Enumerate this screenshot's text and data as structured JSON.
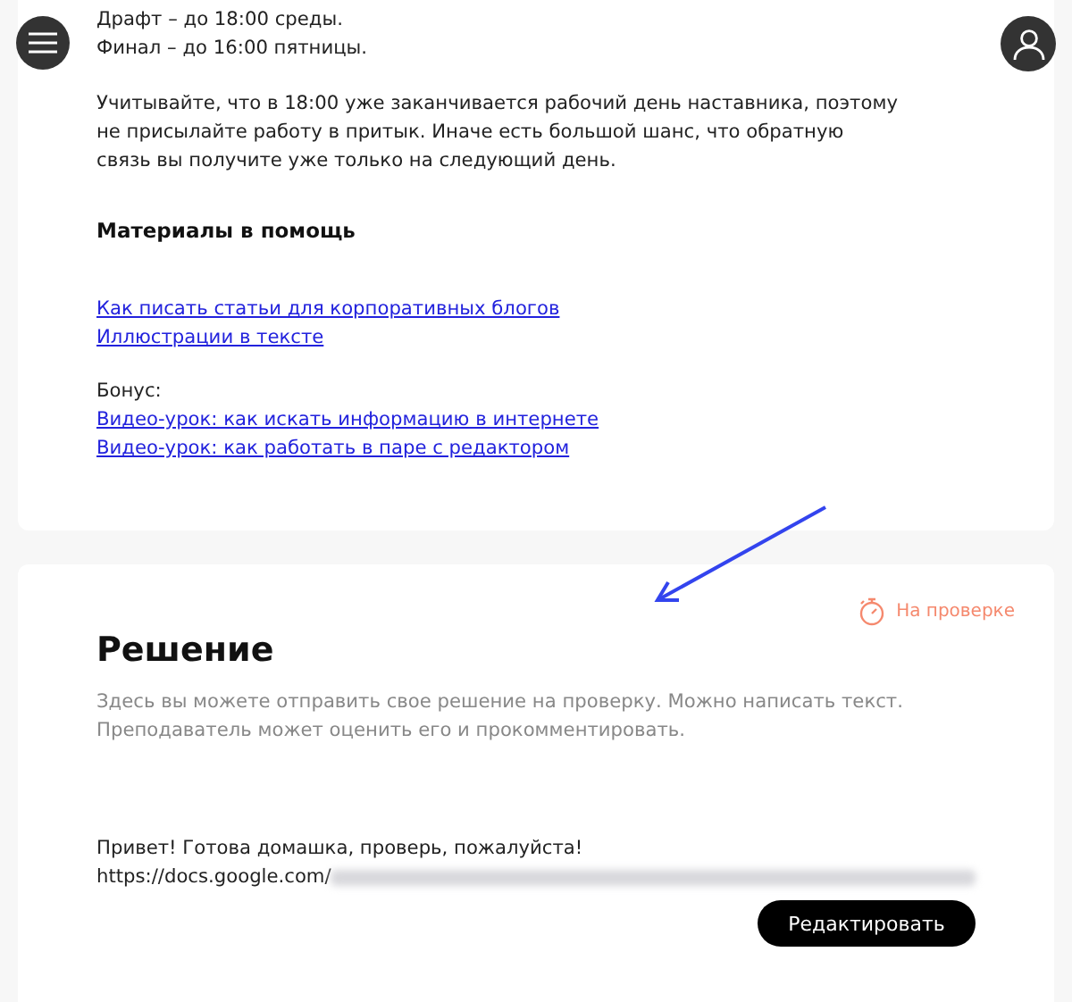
{
  "intro_lines": [
    "Драфт – до 18:00 среды.",
    "Финал – до 16:00 пятницы."
  ],
  "note": "Учитывайте, что в 18:00 уже заканчивается рабочий день наставника, поэтому не присылайте работу в притык. Иначе есть большой шанс, что обратную связь вы получите уже только на следующий день.",
  "materials": {
    "title": "Материалы в помощь",
    "links": [
      "Как писать статьи для корпоративных блогов",
      "Иллюстрации в тексте"
    ],
    "bonus_label": "Бонус:",
    "bonus_links": [
      "Видео-урок: как искать информацию в интернете",
      "Видео-урок: как работать в паре с редактором"
    ]
  },
  "solution": {
    "title": "Решение",
    "status": "На проверке",
    "description": "Здесь вы можете отправить свое решение на проверку. Можно написать текст. Преподаватель может оценить его и прокомментировать.",
    "message": "Привет! Готова домашка, проверь, пожалуйста!",
    "link_prefix": "https://docs.google.com/",
    "edit_button": "Редактировать"
  }
}
